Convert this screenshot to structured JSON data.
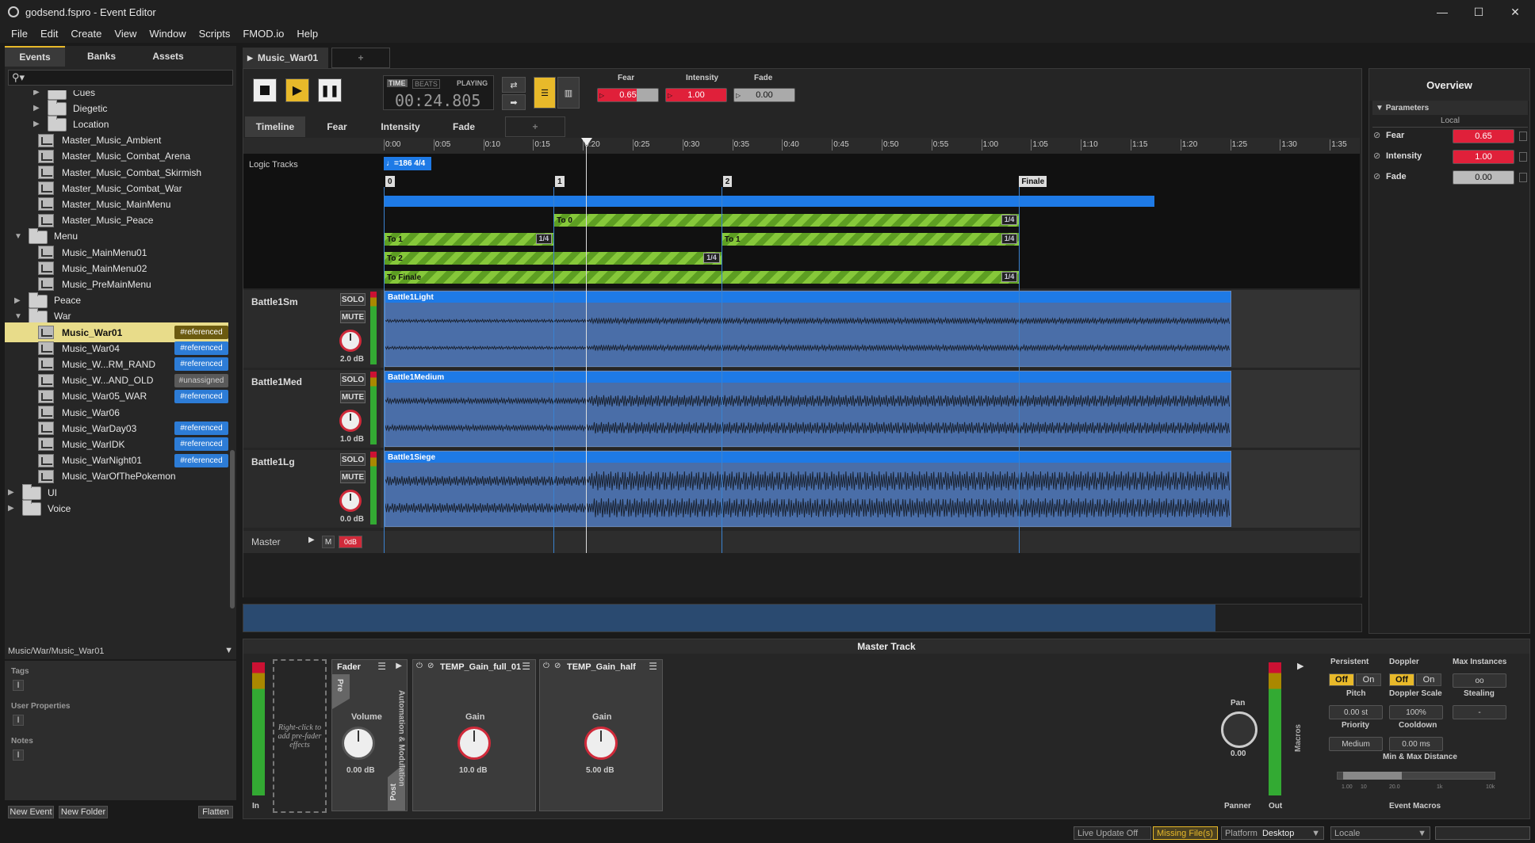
{
  "window": {
    "title": "godsend.fspro - Event Editor",
    "minimize": "—",
    "maximize": "☐",
    "close": "✕"
  },
  "menu": [
    "File",
    "Edit",
    "Create",
    "View",
    "Window",
    "Scripts",
    "FMOD.io",
    "Help"
  ],
  "browser": {
    "tabs": [
      "Events",
      "Banks",
      "Assets"
    ],
    "search_placeholder": "",
    "tree": [
      {
        "label": "Cues",
        "type": "folder",
        "level": 1,
        "expanded": false
      },
      {
        "label": "Diegetic",
        "type": "folder",
        "level": 1,
        "expanded": false
      },
      {
        "label": "Location",
        "type": "folder",
        "level": 1,
        "expanded": false
      },
      {
        "label": "Master_Music_Ambient",
        "type": "event",
        "level": 1
      },
      {
        "label": "Master_Music_Combat_Arena",
        "type": "event",
        "level": 1
      },
      {
        "label": "Master_Music_Combat_Skirmish",
        "type": "event",
        "level": 1
      },
      {
        "label": "Master_Music_Combat_War",
        "type": "event",
        "level": 1
      },
      {
        "label": "Master_Music_MainMenu",
        "type": "event",
        "level": 1
      },
      {
        "label": "Master_Music_Peace",
        "type": "event",
        "level": 1
      },
      {
        "label": "Menu",
        "type": "folder",
        "level": 0,
        "expanded": true
      },
      {
        "label": "Music_MainMenu01",
        "type": "event",
        "level": 1
      },
      {
        "label": "Music_MainMenu02",
        "type": "event",
        "level": 1
      },
      {
        "label": "Music_PreMainMenu",
        "type": "event",
        "level": 1
      },
      {
        "label": "Peace",
        "type": "folder",
        "level": 0,
        "expanded": false
      },
      {
        "label": "War",
        "type": "folder",
        "level": 0,
        "expanded": true
      },
      {
        "label": "Music_War01",
        "type": "event",
        "level": 1,
        "badge": "#referenced",
        "selected": true
      },
      {
        "label": "Music_War04",
        "type": "event",
        "level": 1,
        "badge": "#referenced"
      },
      {
        "label": "Music_W...RM_RAND",
        "type": "event",
        "level": 1,
        "badge": "#referenced"
      },
      {
        "label": "Music_W...AND_OLD",
        "type": "event",
        "level": 1,
        "badge": "#unassigned"
      },
      {
        "label": "Music_War05_WAR",
        "type": "event",
        "level": 1,
        "badge": "#referenced"
      },
      {
        "label": "Music_War06",
        "type": "event",
        "level": 1
      },
      {
        "label": "Music_WarDay03",
        "type": "event",
        "level": 1,
        "badge": "#referenced"
      },
      {
        "label": "Music_WarIDK",
        "type": "event",
        "level": 1,
        "badge": "#referenced"
      },
      {
        "label": "Music_WarNight01",
        "type": "event",
        "level": 1,
        "badge": "#referenced"
      },
      {
        "label": "Music_WarOfThePokemon",
        "type": "event",
        "level": 1
      },
      {
        "label": "UI",
        "type": "folder",
        "level": -1,
        "expanded": false
      },
      {
        "label": "Voice",
        "type": "folder",
        "level": -1,
        "expanded": false
      }
    ],
    "path": "Music/War/Music_War01",
    "tags_label": "Tags",
    "user_props_label": "User Properties",
    "notes_label": "Notes",
    "new_event": "New Event",
    "new_folder": "New Folder",
    "flatten": "Flatten"
  },
  "editor": {
    "event_tab": "Music_War01",
    "add_tab": "+",
    "time_mode": "TIME",
    "beats_mode": "BEATS",
    "state": "PLAYING",
    "time": "00:24.805",
    "params": [
      {
        "name": "Fear",
        "value": "0.65",
        "fill": 0.65,
        "color": "#e0203a"
      },
      {
        "name": "Intensity",
        "value": "1.00",
        "fill": 1.0,
        "color": "#e0203a"
      },
      {
        "name": "Fade",
        "value": "0.00",
        "fill": 0.0,
        "color": "#bbbbbb"
      }
    ],
    "sheet_tabs": [
      "Timeline",
      "Fear",
      "Intensity",
      "Fade"
    ],
    "ruler": [
      "0:00",
      "0:05",
      "0:10",
      "0:15",
      "0:20",
      "0:25",
      "0:30",
      "0:35",
      "0:40",
      "0:45",
      "0:50",
      "0:55",
      "1:00",
      "1:05",
      "1:10",
      "1:15",
      "1:20",
      "1:25",
      "1:30",
      "1:35"
    ],
    "logic_tracks_label": "Logic Tracks",
    "tempo": "=186 4/4",
    "markers": [
      "0",
      "1",
      "2",
      "Finale"
    ],
    "transitions": [
      {
        "label": "To 0",
        "q": "1/4"
      },
      {
        "label": "To 1",
        "q": "1/4"
      },
      {
        "label": "To 1",
        "q": "1/4"
      },
      {
        "label": "To 2",
        "q": "1/4"
      },
      {
        "label": "To Finale",
        "q": "1/4"
      }
    ],
    "tracks": [
      {
        "name": "Battle1Sm",
        "solo": "SOLO",
        "mute": "MUTE",
        "gain": "2.0 dB",
        "region": "Battle1Light"
      },
      {
        "name": "Battle1Med",
        "solo": "SOLO",
        "mute": "MUTE",
        "gain": "1.0 dB",
        "region": "Battle1Medium"
      },
      {
        "name": "Battle1Lg",
        "solo": "SOLO",
        "mute": "MUTE",
        "gain": "0.0 dB",
        "region": "Battle1Siege"
      }
    ],
    "master": {
      "name": "Master",
      "m": "M",
      "vol": "0dB"
    }
  },
  "overview": {
    "title": "Overview",
    "params_hdr": "Parameters",
    "local": "Local",
    "params": [
      {
        "name": "Fear",
        "value": "0.65"
      },
      {
        "name": "Intensity",
        "value": "1.00"
      },
      {
        "name": "Fade",
        "value": "0.00"
      }
    ]
  },
  "deck": {
    "title": "Master Track",
    "in": "In",
    "out": "Out",
    "prefader_hint": "Right-click to add pre-fader effects",
    "fader": {
      "title": "Fader",
      "pre": "Pre",
      "post": "Post",
      "label": "Volume",
      "value": "0.00 dB"
    },
    "automation": "Automation & Modulation",
    "effects": [
      {
        "title": "TEMP_Gain_full_01",
        "label": "Gain",
        "value": "10.0 dB"
      },
      {
        "title": "TEMP_Gain_half",
        "label": "Gain",
        "value": "5.00 dB"
      }
    ],
    "pan": {
      "label": "Pan",
      "value": "0.00",
      "panner": "Panner"
    },
    "macros_side": "Macros",
    "macros": {
      "persistent": "Persistent",
      "doppler": "Doppler",
      "max_instances": "Max Instances",
      "off": "Off",
      "on": "On",
      "max_val": "oo",
      "pitch": "Pitch",
      "pitch_val": "0.00 st",
      "doppler_scale": "Doppler Scale",
      "doppler_scale_val": "100%",
      "stealing": "Stealing",
      "stealing_val": "-",
      "priority": "Priority",
      "priority_val": "Medium",
      "cooldown": "Cooldown",
      "cooldown_val": "0.00 ms",
      "distance": "Min & Max Distance",
      "dist_ticks": [
        "1.00",
        "10",
        "20.0",
        "1k",
        "10k"
      ],
      "footer": "Event Macros"
    }
  },
  "status": {
    "live": "Live Update Off",
    "missing": "Missing File(s)",
    "platform": "Platform",
    "platform_val": "Desktop",
    "locale": "Locale"
  }
}
